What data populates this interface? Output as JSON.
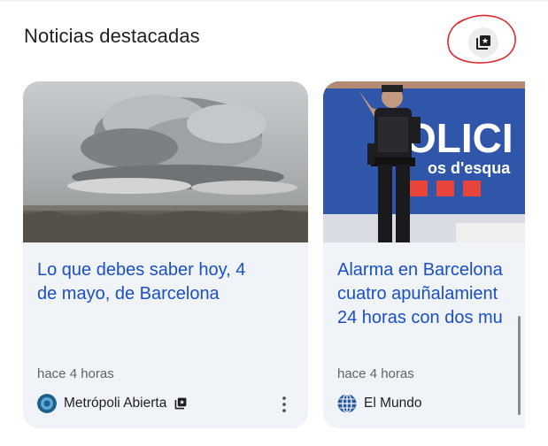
{
  "section": {
    "title": "Noticias destacadas",
    "save_icon": "save-to-collection-icon"
  },
  "cards": [
    {
      "image": "storm-cloud-over-city-photo",
      "headline": "Lo que debes saber hoy, 4\nde mayo, de Barcelona",
      "time": "hace 4 horas",
      "source": "Metrópoli Abierta",
      "source_icon": "metropoli-abierta-logo"
    },
    {
      "image": "police-officer-with-banner-photo",
      "banner_text_1": "OLICI",
      "banner_text_2": "os d'esqua",
      "headline": "Alarma en Barcelona\ncuatro apuñalamient\n24 horas con dos mu",
      "time": "hace 4 horas",
      "source": "El Mundo",
      "source_icon": "el-mundo-globe-logo"
    }
  ],
  "colors": {
    "headline": "#1a4fc5",
    "card_bg": "#f0f4f9",
    "annotation_circle": "#e0282e"
  }
}
